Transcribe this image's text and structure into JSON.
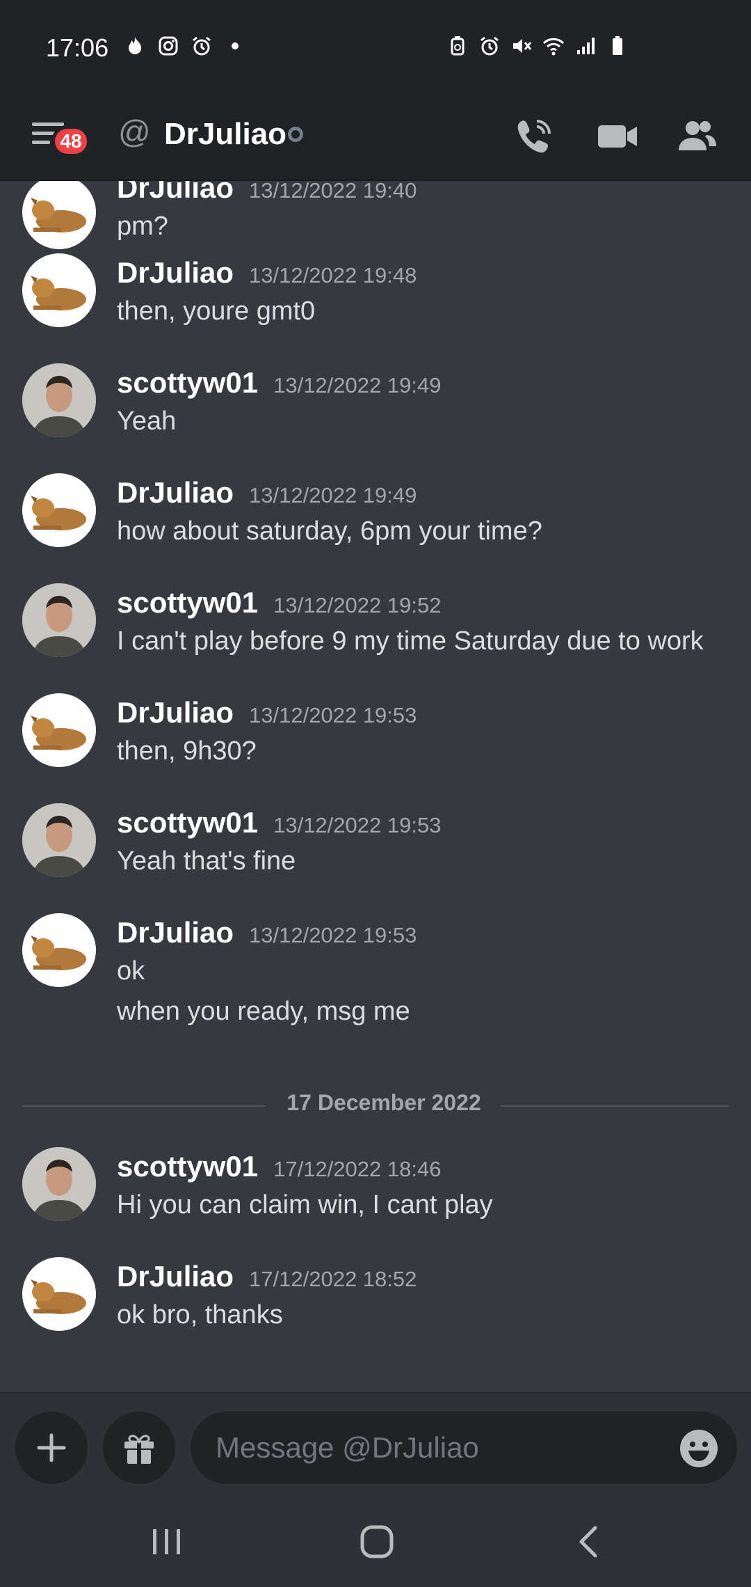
{
  "status_bar": {
    "time": "17:06",
    "left_icons": [
      "flame-icon",
      "instagram-icon",
      "alarm-icon",
      "dot-icon"
    ],
    "right_icons": [
      "battery-saver-icon",
      "alarm-icon",
      "mute-icon",
      "wifi-icon",
      "signal-icon",
      "battery-icon"
    ]
  },
  "header": {
    "badge_count": "48",
    "at_symbol": "@",
    "title": "DrJuliao",
    "actions": [
      "voice-call-icon",
      "video-call-icon",
      "members-icon"
    ]
  },
  "messages": [
    {
      "author": "DrJuliao",
      "timestamp": "13/12/2022 19:40",
      "avatar": "dog",
      "lines": [
        "pm?"
      ]
    },
    {
      "author": "DrJuliao",
      "timestamp": "13/12/2022 19:48",
      "avatar": "dog",
      "lines": [
        "then, youre gmt0"
      ]
    },
    {
      "author": "scottyw01",
      "timestamp": "13/12/2022 19:49",
      "avatar": "person",
      "lines": [
        "Yeah"
      ]
    },
    {
      "author": "DrJuliao",
      "timestamp": "13/12/2022 19:49",
      "avatar": "dog",
      "lines": [
        "how about saturday, 6pm your time?"
      ]
    },
    {
      "author": "scottyw01",
      "timestamp": "13/12/2022 19:52",
      "avatar": "person",
      "lines": [
        "I can't play before 9 my time Saturday due to work"
      ]
    },
    {
      "author": "DrJuliao",
      "timestamp": "13/12/2022 19:53",
      "avatar": "dog",
      "lines": [
        "then, 9h30?"
      ]
    },
    {
      "author": "scottyw01",
      "timestamp": "13/12/2022 19:53",
      "avatar": "person",
      "lines": [
        "Yeah that's fine"
      ]
    },
    {
      "author": "DrJuliao",
      "timestamp": "13/12/2022 19:53",
      "avatar": "dog",
      "lines": [
        "ok",
        "when you ready, msg me"
      ]
    },
    {
      "author": "scottyw01",
      "timestamp": "17/12/2022 18:46",
      "avatar": "person",
      "lines": [
        "Hi you can claim win, I cant play"
      ]
    },
    {
      "author": "DrJuliao",
      "timestamp": "17/12/2022 18:52",
      "avatar": "dog",
      "lines": [
        "ok bro, thanks"
      ]
    }
  ],
  "date_divider": "17 December 2022",
  "composer": {
    "placeholder": "Message @DrJuliao",
    "value": ""
  },
  "nav": [
    "recents-icon",
    "home-icon",
    "back-icon"
  ],
  "colors": {
    "background": "#36393f",
    "header": "#202225",
    "badge": "#ed4245",
    "text": "#dcddde",
    "muted": "#a3a6aa"
  }
}
